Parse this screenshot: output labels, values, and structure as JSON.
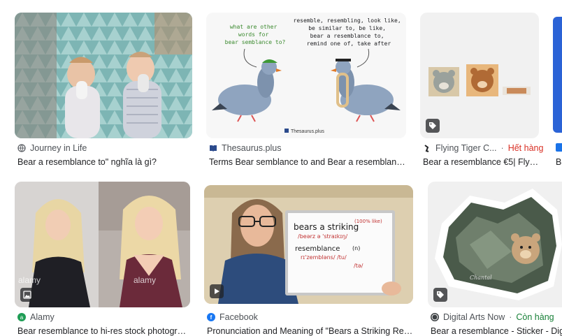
{
  "results": [
    {
      "source": "Journey in Life",
      "title": "Bear a resemblance to\" nghĩa là gì?"
    },
    {
      "source": "Thesaurus.plus",
      "title": "Terms Bear semblance to and Bear a resemblan…"
    },
    {
      "source": "Flying Tiger C...",
      "status": "Hết hàng",
      "title": "Bear a resemblance €5| Flyi…"
    },
    {
      "source": "",
      "title": "Be"
    },
    {
      "source": "Alamy",
      "title": "Bear resemblance to hi-res stock photogra…"
    },
    {
      "source": "Facebook",
      "title": "Pronunciation and Meaning of \"Bears a Striking Res…"
    },
    {
      "source": "Digital Arts Now",
      "status": "Còn hàng",
      "title": "Bear a resemblance - Sticker - Digi"
    }
  ],
  "thesaurus_image": {
    "question": [
      "what are other",
      "words for",
      "bear semblance to?"
    ],
    "answer": [
      "resemble, resembling, look like,",
      "be similar to, be like,",
      "bear a resemblance to,",
      "remind one of, take after"
    ],
    "watermark": "Thesaurus.plus"
  },
  "whiteboard": {
    "line1": "bears a striking",
    "line1_note": "(100% like)",
    "line1_ipa": "/beərz ə 'straɪkɪŋ/",
    "line2": "resemblance",
    "line2_note": "(n)",
    "line2_ipa": "rɪ'zembləns/ /tu/",
    "line2_ipa2": "/tə/"
  },
  "alamy_watermark": "alamy",
  "sticker_signature": "Chantal",
  "colors": {
    "status_red": "#d93025",
    "status_green": "#188038",
    "text": "#202124",
    "meta": "#4d5156"
  }
}
